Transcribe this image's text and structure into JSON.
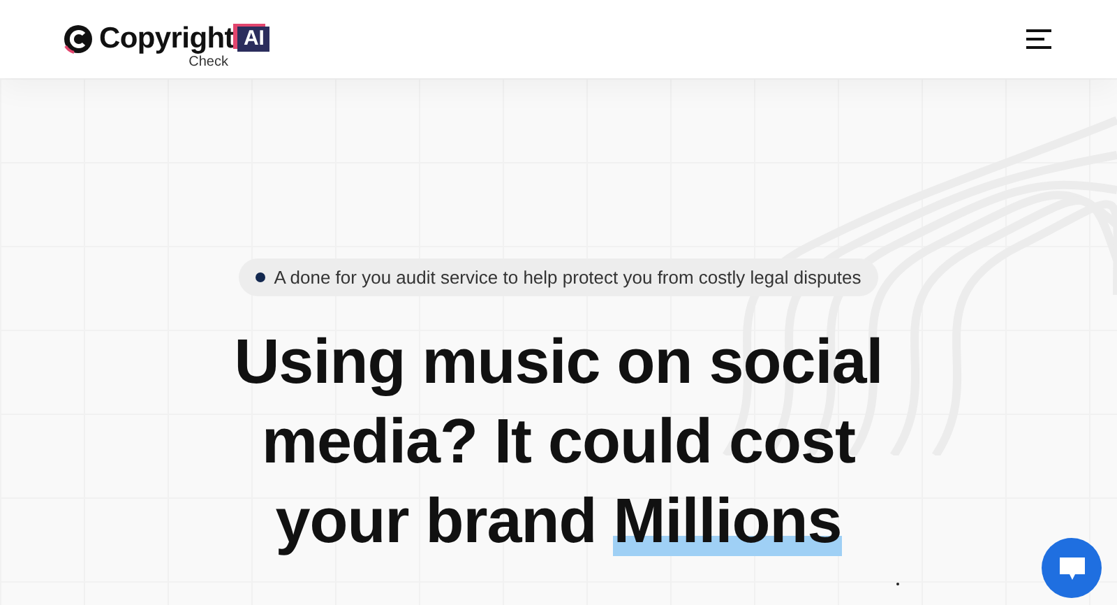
{
  "header": {
    "logo": {
      "name": "Copyright",
      "badge": "AI",
      "subtitle": "Check"
    }
  },
  "hero": {
    "tagline": "A done for you audit service to help protect you from costly legal disputes",
    "headline": [
      {
        "text": "Using music on social media? It could cost your brand ",
        "highlighted": false
      },
      {
        "text": "Millions",
        "highlighted": true
      }
    ]
  }
}
